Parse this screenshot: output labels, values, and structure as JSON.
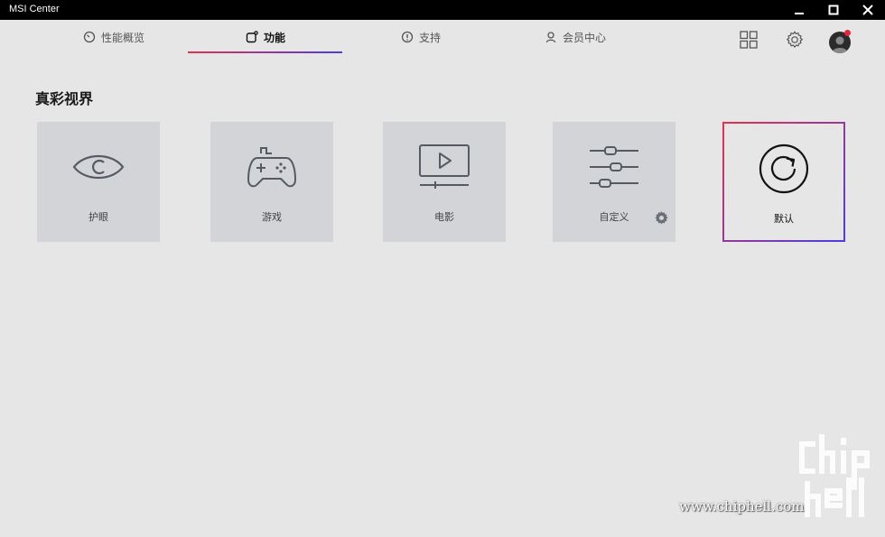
{
  "window": {
    "title": "MSI Center"
  },
  "nav": {
    "tabs": [
      {
        "label": "性能概览",
        "icon": "gauge-icon"
      },
      {
        "label": "功能",
        "icon": "feature-icon",
        "active": true
      },
      {
        "label": "支持",
        "icon": "info-circle-icon"
      },
      {
        "label": "会员中心",
        "icon": "user-icon"
      }
    ]
  },
  "section": {
    "title": "真彩视界"
  },
  "modes": [
    {
      "label": "护眼",
      "icon": "eye-icon"
    },
    {
      "label": "游戏",
      "icon": "gamepad-icon"
    },
    {
      "label": "电影",
      "icon": "video-player-icon"
    },
    {
      "label": "自定义",
      "icon": "sliders-icon"
    },
    {
      "label": "默认",
      "icon": "reset-icon",
      "selected": true
    }
  ],
  "watermark": {
    "text": "www.chiphell.com"
  },
  "colors": {
    "accent_start": "#e63050",
    "accent_end": "#4a3ee0",
    "card_bg": "#d3d4d8",
    "page_bg": "#e6e6e6"
  }
}
